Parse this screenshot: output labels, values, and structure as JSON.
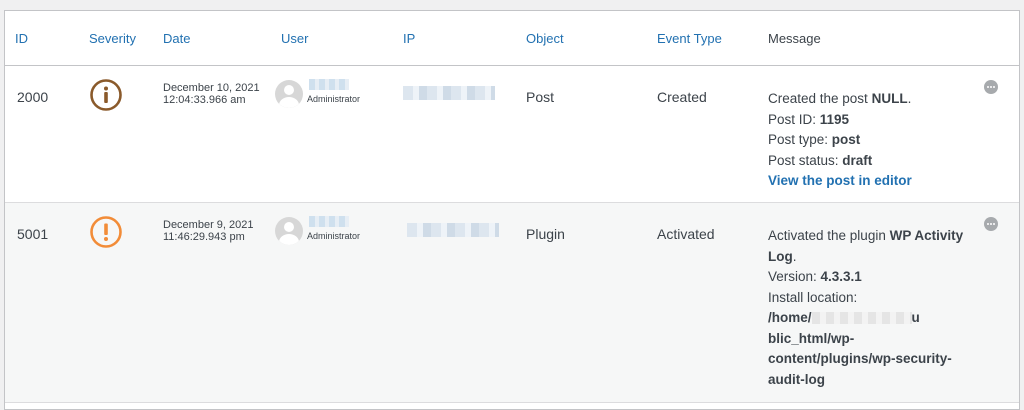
{
  "columns": {
    "id": "ID",
    "severity": "Severity",
    "date": "Date",
    "user": "User",
    "ip": "IP",
    "object": "Object",
    "event_type": "Event Type",
    "message": "Message"
  },
  "colors": {
    "link": "#2271b1",
    "severity_info": "#8a5a2b",
    "severity_warning": "#f28c38",
    "row_alt": "#f6f7f7"
  },
  "rows": [
    {
      "id": "2000",
      "severity_icon": "info-icon",
      "date_line1": "December 10, 2021",
      "date_line2": "12:04:33.966 am",
      "user_role": "Administrator",
      "object": "Post",
      "event_type": "Created",
      "message": {
        "line1_prefix": "Created the post ",
        "line1_bold": "NULL",
        "line1_suffix": ".",
        "line2_label": "Post ID: ",
        "line2_value": "1195",
        "line3_label": "Post type: ",
        "line3_value": "post",
        "line4_label": "Post status: ",
        "line4_value": "draft",
        "link": "View the post in editor"
      }
    },
    {
      "id": "5001",
      "severity_icon": "warning-icon",
      "date_line1": "December 9, 2021",
      "date_line2": "11:46:29.943 pm",
      "user_role": "Administrator",
      "object": "Plugin",
      "event_type": "Activated",
      "message": {
        "line1_prefix": "Activated the plugin ",
        "line1_bold_a": "WP Activity",
        "line1_bold_b": "Log",
        "line1_suffix": ".",
        "version_label": "Version: ",
        "version_value": "4.3.3.1",
        "location_label": "Install location:",
        "path_start": "/home/",
        "path_mid": "u",
        "path_line2": "blic_html/wp-",
        "path_line3": "content/plugins/wp-security-",
        "path_line4": "audit-log"
      }
    }
  ]
}
